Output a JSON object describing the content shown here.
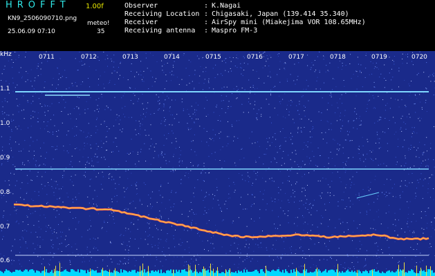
{
  "header": {
    "app_title": "HROFFT",
    "version": "1.00f",
    "filename": "KN9_2506090710.png",
    "timestamp": "25.06.09 07:10",
    "meteor_label": "meteo!",
    "meteor_count": "35"
  },
  "info": [
    {
      "label": "Observer",
      "sep": ":",
      "value": "K.Nagai"
    },
    {
      "label": "Receiving Location",
      "sep": ":",
      "value": "Chigasaki, Japan (139.414 35.340)"
    },
    {
      "label": "Receiver",
      "sep": ":",
      "value": "AirSpy mini (Miakejima VOR 108.65MHz)"
    },
    {
      "label": "Receiving antenna",
      "sep": ":",
      "value": "Maspro FM-3"
    }
  ],
  "axis": {
    "unit": "kHz",
    "y_ticks": [
      "1.1",
      "1.0",
      "0.9",
      "0.8",
      "0.7",
      "0.6"
    ],
    "time_ticks": [
      "0711",
      "0712",
      "0713",
      "0714",
      "0715",
      "0716",
      "0717",
      "0718",
      "0719",
      "0720"
    ]
  },
  "colors": {
    "background": "#1a2a8a",
    "header_title": "#2fe8e8",
    "version": "#e8e800",
    "carrier_line": "#7fd8ff",
    "drift_trace": "#ff6a4a",
    "meteor_bars": "#00d8ff"
  }
}
